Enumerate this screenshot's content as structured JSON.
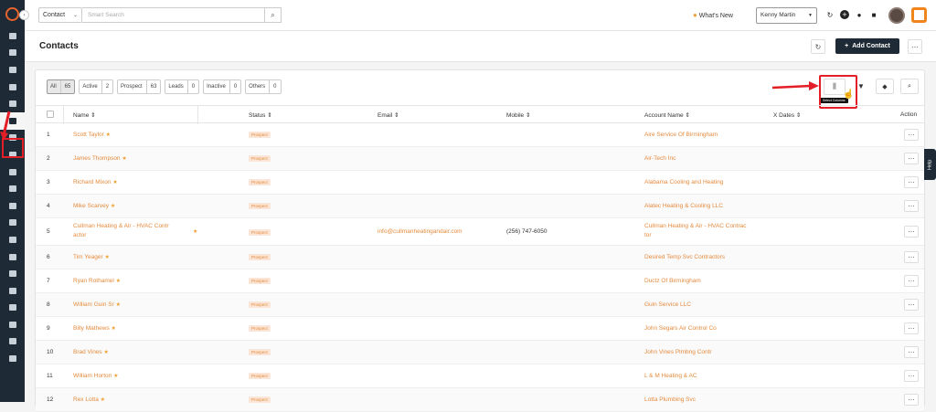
{
  "topbar": {
    "module_select": "Contact",
    "search_placeholder": "Smart Search",
    "whats_new": "What's New",
    "user_select": "Kenny Martin"
  },
  "header": {
    "title": "Contacts",
    "add_contact": "Add Contact"
  },
  "filters": [
    {
      "label": "All",
      "count": "65",
      "active": true
    },
    {
      "label": "Active",
      "count": "2"
    },
    {
      "label": "Prospect",
      "count": "63"
    },
    {
      "label": "Leads",
      "count": "0"
    },
    {
      "label": "Inactive",
      "count": "0"
    },
    {
      "label": "Others",
      "count": "0"
    }
  ],
  "tooltip": "Select Columns",
  "table": {
    "columns": {
      "name": "Name",
      "status": "Status",
      "email": "Email",
      "mobile": "Mobile",
      "account": "Account Name",
      "xdates": "X Dates",
      "action": "Action"
    },
    "rows": [
      {
        "num": "1",
        "name": "Scott Taylor",
        "status": "Prospect",
        "email": "",
        "mobile": "",
        "account": "Aire Service Of Birmingham"
      },
      {
        "num": "2",
        "name": "James Thompson",
        "status": "Prospect",
        "email": "",
        "mobile": "",
        "account": "Air-Tech Inc"
      },
      {
        "num": "3",
        "name": "Richard Mixon",
        "status": "Prospect",
        "email": "",
        "mobile": "",
        "account": "Alabama Cooling and Heating"
      },
      {
        "num": "4",
        "name": "Mike Scarvey",
        "status": "Prospect",
        "email": "",
        "mobile": "",
        "account": "Alatec Heating & Cooling LLC"
      },
      {
        "num": "5",
        "name": "Cullman Heating & Air - HVAC Contr",
        "name2": "actor",
        "status": "Prospect",
        "email": "info@cullmanheatingandair.com",
        "mobile": "(256) 747-6050",
        "account": "Cullman Heating & Air - HVAC Contrac",
        "account2": "tor"
      },
      {
        "num": "6",
        "name": "Tim Yeager",
        "status": "Prospect",
        "email": "",
        "mobile": "",
        "account": "Desired Temp Svc Contractors"
      },
      {
        "num": "7",
        "name": "Ryan Rothamel",
        "status": "Prospect",
        "email": "",
        "mobile": "",
        "account": "Ductz Of Birmingham"
      },
      {
        "num": "8",
        "name": "William Guin Sr",
        "status": "Prospect",
        "email": "",
        "mobile": "",
        "account": "Guin Service LLC"
      },
      {
        "num": "9",
        "name": "Billy Mathews",
        "status": "Prospect",
        "email": "",
        "mobile": "",
        "account": "John Segars Air Control Co"
      },
      {
        "num": "10",
        "name": "Brad Vines",
        "status": "Prospect",
        "email": "",
        "mobile": "",
        "account": "John Vines Plmbng Contr"
      },
      {
        "num": "11",
        "name": "William Horton",
        "status": "Prospect",
        "email": "",
        "mobile": "",
        "account": "L & M Heating & AC"
      },
      {
        "num": "12",
        "name": "Rex Lotta",
        "status": "Prospect",
        "email": "",
        "mobile": "",
        "account": "Lotta Plumbing Svc"
      }
    ]
  },
  "help_label": "Help",
  "colors": {
    "accent": "#e58a3c",
    "sidebar": "#1e2a35",
    "highlight": "#e41e26"
  }
}
